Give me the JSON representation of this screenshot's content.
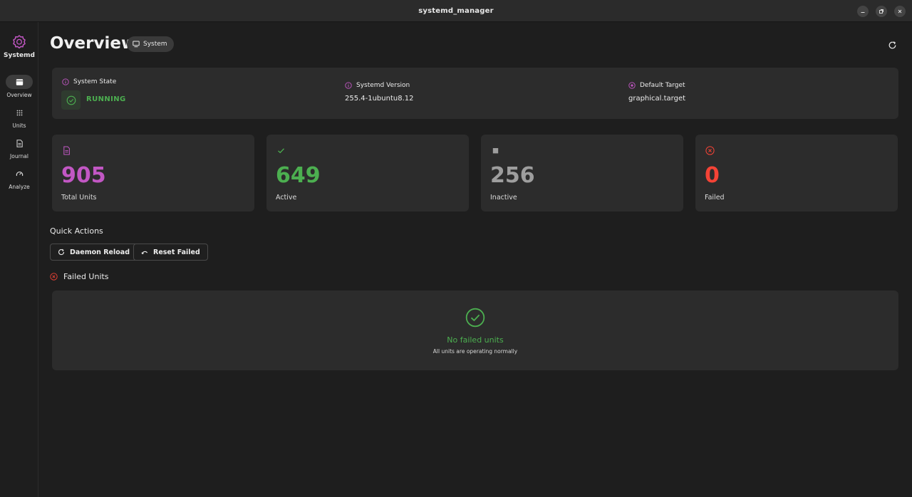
{
  "window": {
    "title": "systemd_manager",
    "controls": [
      "minimize-icon",
      "restore-icon",
      "close-icon"
    ]
  },
  "sidebar": {
    "brand_label": "Systemd",
    "items": [
      {
        "label": "Overview",
        "icon": "dashboard-icon",
        "active": true
      },
      {
        "label": "Units",
        "icon": "grid-icon",
        "active": false
      },
      {
        "label": "Journal",
        "icon": "document-icon",
        "active": false
      },
      {
        "label": "Analyze",
        "icon": "gauge-icon",
        "active": false
      }
    ]
  },
  "header": {
    "title": "Overview",
    "scope_chip": "System"
  },
  "system_info": {
    "state_label": "System State",
    "state_value": "RUNNING",
    "version_label": "Systemd Version",
    "version_value": "255.4-1ubuntu8.12",
    "target_label": "Default Target",
    "target_value": "graphical.target"
  },
  "stats": [
    {
      "value": "905",
      "label": "Total Units",
      "color": "#c257c4",
      "icon": "file-icon"
    },
    {
      "value": "649",
      "label": "Active",
      "color": "#4caf50",
      "icon": "check-icon"
    },
    {
      "value": "256",
      "label": "Inactive",
      "color": "#9e9e9e",
      "icon": "stop-icon"
    },
    {
      "value": "0",
      "label": "Failed",
      "color": "#f44336",
      "icon": "x-circle-icon"
    }
  ],
  "quick_actions": {
    "title": "Quick Actions",
    "daemon_reload": "Daemon Reload",
    "reset_failed": "Reset Failed"
  },
  "failed_units": {
    "title": "Failed Units",
    "empty_title": "No failed units",
    "empty_subtitle": "All units are operating normally"
  },
  "colors": {
    "accent": "#c257c4",
    "success": "#4caf50",
    "danger": "#f44336",
    "muted": "#9e9e9e"
  }
}
